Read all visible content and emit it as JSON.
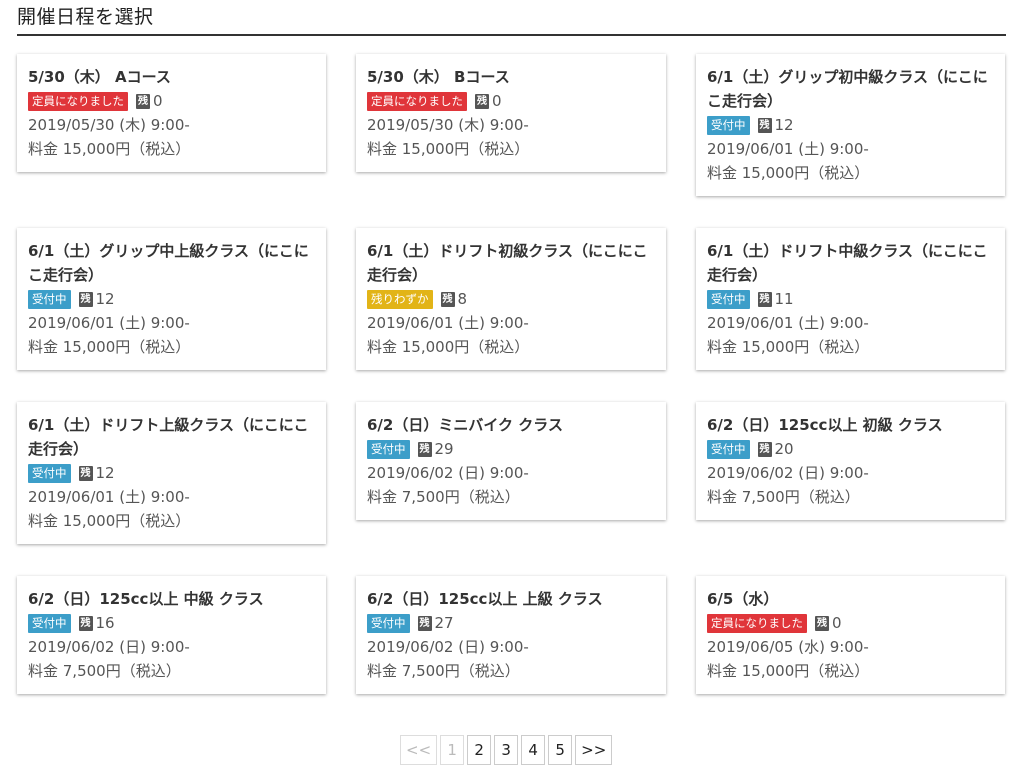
{
  "page_title": "開催日程を選択",
  "remain_icon_text": "残",
  "colors": {
    "full": "#e0353a",
    "open": "#3c9ec9",
    "few": "#e2b417"
  },
  "cards": [
    {
      "title": "5/30（木） Aコース",
      "status": "定員になりました",
      "status_type": "full",
      "remain": "0",
      "datetime": "2019/05/30 (木) 9:00-",
      "price": "料金 15,000円（税込）"
    },
    {
      "title": "5/30（木） Bコース",
      "status": "定員になりました",
      "status_type": "full",
      "remain": "0",
      "datetime": "2019/05/30 (木) 9:00-",
      "price": "料金 15,000円（税込）"
    },
    {
      "title": "6/1（土）グリップ初中級クラス（にこにこ走行会）",
      "status": "受付中",
      "status_type": "open",
      "remain": "12",
      "datetime": "2019/06/01 (土) 9:00-",
      "price": "料金 15,000円（税込）"
    },
    {
      "title": "6/1（土）グリップ中上級クラス（にこにこ走行会）",
      "status": "受付中",
      "status_type": "open",
      "remain": "12",
      "datetime": "2019/06/01 (土) 9:00-",
      "price": "料金 15,000円（税込）"
    },
    {
      "title": "6/1（土）ドリフト初級クラス（にこにこ走行会）",
      "status": "残りわずか",
      "status_type": "few",
      "remain": "8",
      "datetime": "2019/06/01 (土) 9:00-",
      "price": "料金 15,000円（税込）"
    },
    {
      "title": "6/1（土）ドリフト中級クラス（にこにこ走行会）",
      "status": "受付中",
      "status_type": "open",
      "remain": "11",
      "datetime": "2019/06/01 (土) 9:00-",
      "price": "料金 15,000円（税込）"
    },
    {
      "title": "6/1（土）ドリフト上級クラス（にこにこ走行会）",
      "status": "受付中",
      "status_type": "open",
      "remain": "12",
      "datetime": "2019/06/01 (土) 9:00-",
      "price": "料金 15,000円（税込）"
    },
    {
      "title": "6/2（日）ミニバイク クラス",
      "status": "受付中",
      "status_type": "open",
      "remain": "29",
      "datetime": "2019/06/02 (日) 9:00-",
      "price": "料金 7,500円（税込）"
    },
    {
      "title": "6/2（日）125cc以上 初級 クラス",
      "status": "受付中",
      "status_type": "open",
      "remain": "20",
      "datetime": "2019/06/02 (日) 9:00-",
      "price": "料金 7,500円（税込）"
    },
    {
      "title": "6/2（日）125cc以上 中級 クラス",
      "status": "受付中",
      "status_type": "open",
      "remain": "16",
      "datetime": "2019/06/02 (日) 9:00-",
      "price": "料金 7,500円（税込）"
    },
    {
      "title": "6/2（日）125cc以上 上級 クラス",
      "status": "受付中",
      "status_type": "open",
      "remain": "27",
      "datetime": "2019/06/02 (日) 9:00-",
      "price": "料金 7,500円（税込）"
    },
    {
      "title": "6/5（水）",
      "status": "定員になりました",
      "status_type": "full",
      "remain": "0",
      "datetime": "2019/06/05 (水) 9:00-",
      "price": "料金 15,000円（税込）"
    }
  ],
  "pagination": {
    "prev": "<<",
    "pages": [
      "1",
      "2",
      "3",
      "4",
      "5"
    ],
    "current": "1",
    "next": ">>"
  }
}
